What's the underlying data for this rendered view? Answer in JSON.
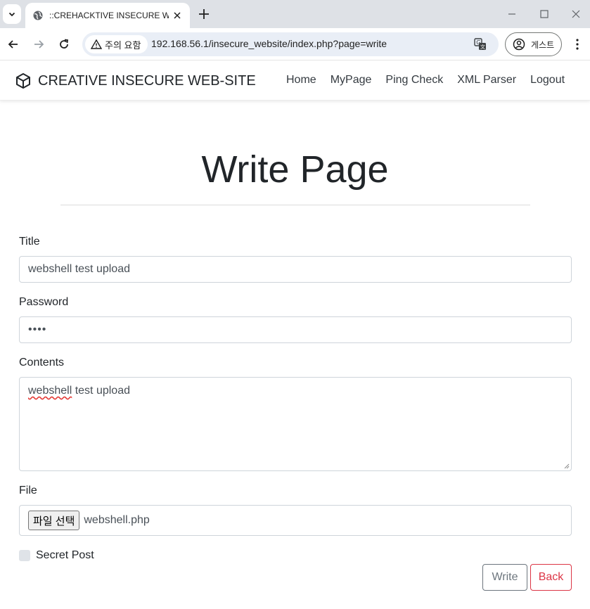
{
  "browser": {
    "tab_title": "::CREHACKTIVE INSECURE WEB",
    "security_chip": "주의 요함",
    "url": "192.168.56.1/insecure_website/index.php?page=write",
    "profile_label": "게스트"
  },
  "navbar": {
    "brand": "CREATIVE INSECURE WEB-SITE",
    "links": [
      "Home",
      "MyPage",
      "Ping Check",
      "XML Parser",
      "Logout"
    ]
  },
  "page": {
    "heading": "Write Page"
  },
  "form": {
    "title_label": "Title",
    "title_value": "webshell test upload",
    "password_label": "Password",
    "password_value": "••••",
    "contents_label": "Contents",
    "contents_word1": "webshell",
    "contents_rest": " test upload",
    "file_label": "File",
    "file_button": "파일 선택",
    "file_name": "webshell.php",
    "secret_label": "Secret Post",
    "write_button": "Write",
    "back_button": "Back"
  }
}
